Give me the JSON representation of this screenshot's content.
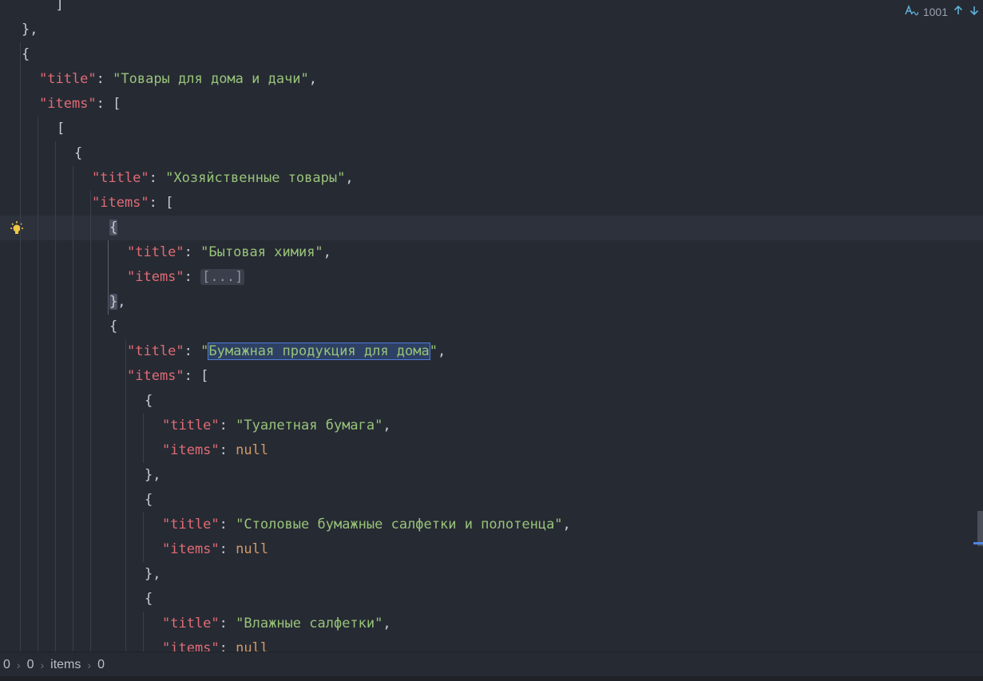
{
  "search": {
    "match_icon": "regex-case-icon",
    "count": "1001",
    "prev_icon": "arrow-up-icon",
    "next_icon": "arrow-down-icon"
  },
  "lines": [
    [
      "  ]"
    ],
    [
      "},"
    ],
    [
      "{"
    ],
    [
      "\"title\"",
      ": ",
      "\"Товары для дома и дачи\"",
      ","
    ],
    [
      "\"items\"",
      ": ["
    ],
    [
      "["
    ],
    [
      "{"
    ],
    [
      "\"title\"",
      ": ",
      "\"Хозяйственные товары\"",
      ","
    ],
    [
      "\"items\"",
      ": ["
    ],
    [
      "{"
    ],
    [
      "\"title\"",
      ": ",
      "\"Бытовая химия\"",
      ","
    ],
    [
      "\"items\"",
      ": ",
      "[...]"
    ],
    [
      "},"
    ],
    [
      "{"
    ],
    [
      "\"title\"",
      ": ",
      "\"",
      "Бумажная продукция для дома",
      "\"",
      ","
    ],
    [
      "\"items\"",
      ": ["
    ],
    [
      "{"
    ],
    [
      "\"title\"",
      ": ",
      "\"Туалетная бумага\"",
      ","
    ],
    [
      "\"items\"",
      ": ",
      "null"
    ],
    [
      "},"
    ],
    [
      "{"
    ],
    [
      "\"title\"",
      ": ",
      "\"Столовые бумажные салфетки и полотенца\"",
      ","
    ],
    [
      "\"items\"",
      ": ",
      "null"
    ],
    [
      "},"
    ],
    [
      "{"
    ],
    [
      "\"title\"",
      ": ",
      "\"Влажные салфетки\"",
      ","
    ],
    [
      "\"items\"",
      ": ",
      "null"
    ]
  ],
  "breadcrumb": [
    "0",
    "0",
    "items",
    "0"
  ],
  "colors": {
    "background": "#262a33",
    "key": "#e06c75",
    "string": "#98c379",
    "keyword": "#d19a66",
    "accent": "#4f86e0"
  }
}
